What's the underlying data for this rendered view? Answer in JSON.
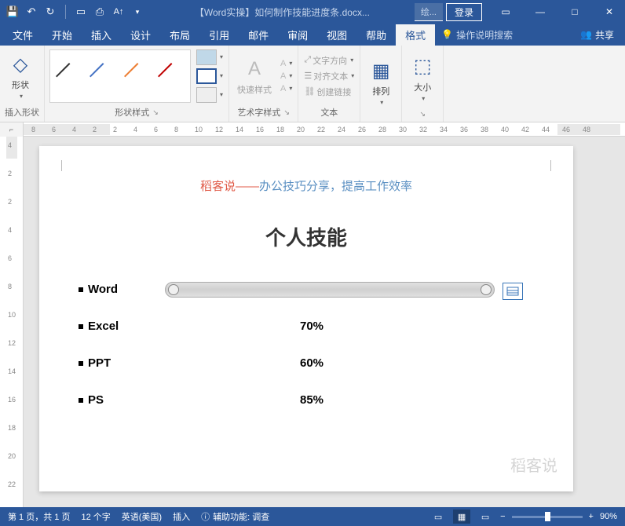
{
  "titleBar": {
    "docTitle": "【Word实操】如何制作技能进度条.docx...",
    "drawingTools": "绘...",
    "login": "登录"
  },
  "tabs": [
    "文件",
    "开始",
    "插入",
    "设计",
    "布局",
    "引用",
    "邮件",
    "审阅",
    "视图",
    "帮助",
    "格式"
  ],
  "activeTab": "格式",
  "tellMe": "操作说明搜索",
  "share": "共享",
  "ribbon": {
    "insertShape": "插入形状",
    "shapes": "形状",
    "shapeStyles": "形状样式",
    "wordArtStyles": "艺术字样式",
    "quickStyles": "快速样式",
    "text": "文本",
    "textDirection": "文字方向",
    "alignText": "对齐文本",
    "createLink": "创建链接",
    "arrange": "排列",
    "size": "大小"
  },
  "rulerH": [
    -8,
    -6,
    -4,
    -2,
    2,
    4,
    6,
    8,
    10,
    12,
    14,
    16,
    18,
    20,
    22,
    24,
    26,
    28,
    30,
    32,
    34,
    36,
    38,
    40,
    42,
    44,
    46,
    48
  ],
  "rulerV": [
    -4,
    -2,
    2,
    4,
    6,
    8,
    10,
    12,
    14,
    16,
    18,
    20,
    22
  ],
  "doc": {
    "headerRed": "稻客说——",
    "headerBlue": "办公技巧分享，提高工作效率",
    "title": "个人技能",
    "skills": [
      {
        "name": "Word",
        "value": ""
      },
      {
        "name": "Excel",
        "value": "70%"
      },
      {
        "name": "PPT",
        "value": "60%"
      },
      {
        "name": "PS",
        "value": "85%"
      }
    ],
    "watermark": "稻客说"
  },
  "statusBar": {
    "page": "第 1 页，共 1 页",
    "words": "12 个字",
    "lang": "英语(美国)",
    "insert": "插入",
    "a11y": "辅助功能: 调查",
    "zoom": "90%"
  }
}
